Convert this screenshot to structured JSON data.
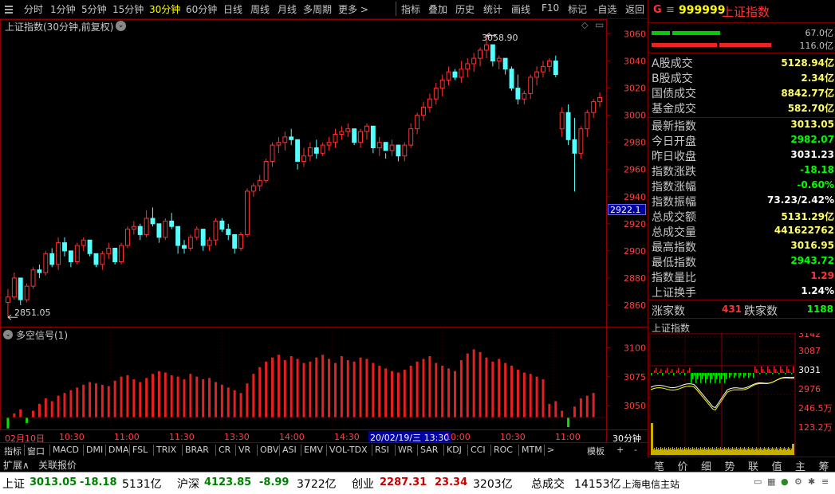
{
  "toolbar": {
    "left": [
      "分时",
      "1分钟",
      "5分钟",
      "15分钟",
      "30分钟",
      "60分钟",
      "日线",
      "周线",
      "月线",
      "多周期",
      "更多 >"
    ],
    "active_index": 4,
    "right": [
      "指标",
      "叠加",
      "历史",
      "统计",
      "画线",
      "F10",
      "标记",
      "-自选",
      "返回"
    ]
  },
  "chart": {
    "title": "上证指数(30分钟,前复权)",
    "high_label": "3058.90",
    "low_label": "2851.05",
    "price_ticks": [
      "3060",
      "3040",
      "3020",
      "3000",
      "2980",
      "2960",
      "2940",
      "2920",
      "2900",
      "2880",
      "2860"
    ],
    "current_tag": "2922.1",
    "indicator_title": "多空信号(1)",
    "indicator_ticks": [
      "3100",
      "3075",
      "3050"
    ],
    "time_labels": [
      "02月10日",
      "10:30",
      "11:00",
      "11:30",
      "13:30",
      "14:00",
      "14:30",
      "20/02/19/三 13:30",
      "10:00",
      "10:30",
      "11:00"
    ],
    "period_label": "30分钟"
  },
  "chart_data": {
    "type": "candlestick",
    "title": "上证指数(30分钟,前复权)",
    "ylim": [
      2850,
      3065
    ],
    "high": 3058.9,
    "low": 2851.05,
    "ohlc": [
      [
        2862,
        2872,
        2851,
        2866
      ],
      [
        2866,
        2884,
        2864,
        2880
      ],
      [
        2880,
        2876,
        2860,
        2864
      ],
      [
        2864,
        2876,
        2862,
        2874
      ],
      [
        2874,
        2888,
        2872,
        2886
      ],
      [
        2886,
        2890,
        2880,
        2884
      ],
      [
        2884,
        2900,
        2882,
        2898
      ],
      [
        2898,
        2902,
        2888,
        2890
      ],
      [
        2890,
        2910,
        2886,
        2906
      ],
      [
        2906,
        2910,
        2896,
        2900
      ],
      [
        2900,
        2898,
        2888,
        2892
      ],
      [
        2892,
        2906,
        2890,
        2904
      ],
      [
        2904,
        2910,
        2900,
        2908
      ],
      [
        2908,
        2906,
        2896,
        2898
      ],
      [
        2898,
        2894,
        2888,
        2890
      ],
      [
        2890,
        2900,
        2886,
        2898
      ],
      [
        2898,
        2906,
        2894,
        2902
      ],
      [
        2902,
        2898,
        2890,
        2892
      ],
      [
        2892,
        2906,
        2890,
        2904
      ],
      [
        2904,
        2918,
        2902,
        2916
      ],
      [
        2916,
        2922,
        2912,
        2918
      ],
      [
        2918,
        2920,
        2908,
        2912
      ],
      [
        2912,
        2930,
        2910,
        2924
      ],
      [
        2924,
        2932,
        2918,
        2920
      ],
      [
        2920,
        2914,
        2906,
        2910
      ],
      [
        2910,
        2924,
        2908,
        2922
      ],
      [
        2922,
        2928,
        2916,
        2918
      ],
      [
        2918,
        2910,
        2898,
        2904
      ],
      [
        2904,
        2908,
        2898,
        2902
      ],
      [
        2902,
        2912,
        2900,
        2910
      ],
      [
        2910,
        2918,
        2908,
        2916
      ],
      [
        2916,
        2912,
        2900,
        2904
      ],
      [
        2904,
        2910,
        2900,
        2908
      ],
      [
        2908,
        2924,
        2904,
        2922
      ],
      [
        2922,
        2924,
        2914,
        2916
      ],
      [
        2916,
        2920,
        2908,
        2912
      ],
      [
        2912,
        2904,
        2898,
        2902
      ],
      [
        2902,
        2914,
        2900,
        2912
      ],
      [
        2912,
        2946,
        2910,
        2944
      ],
      [
        2944,
        2950,
        2940,
        2948
      ],
      [
        2948,
        2956,
        2944,
        2952
      ],
      [
        2952,
        2968,
        2950,
        2966
      ],
      [
        2966,
        2980,
        2962,
        2978
      ],
      [
        2978,
        2984,
        2972,
        2980
      ],
      [
        2980,
        2988,
        2974,
        2984
      ],
      [
        2984,
        2990,
        2978,
        2982
      ],
      [
        2982,
        2964,
        2960,
        2966
      ],
      [
        2966,
        2976,
        2962,
        2970
      ],
      [
        2970,
        2980,
        2966,
        2976
      ],
      [
        2976,
        2982,
        2968,
        2972
      ],
      [
        2972,
        2980,
        2970,
        2978
      ],
      [
        2978,
        2984,
        2974,
        2980
      ],
      [
        2980,
        2990,
        2976,
        2986
      ],
      [
        2986,
        2992,
        2982,
        2988
      ],
      [
        2988,
        2994,
        2984,
        2990
      ],
      [
        2990,
        2982,
        2978,
        2980
      ],
      [
        2980,
        2990,
        2976,
        2988
      ],
      [
        2988,
        2994,
        2982,
        2992
      ],
      [
        2992,
        2980,
        2972,
        2976
      ],
      [
        2976,
        2984,
        2970,
        2980
      ],
      [
        2980,
        2972,
        2968,
        2974
      ],
      [
        2974,
        2982,
        2970,
        2978
      ],
      [
        2978,
        2972,
        2966,
        2970
      ],
      [
        2970,
        2980,
        2966,
        2978
      ],
      [
        2978,
        2994,
        2976,
        2990
      ],
      [
        2990,
        3002,
        2986,
        3000
      ],
      [
        3000,
        3010,
        2996,
        3006
      ],
      [
        3006,
        3016,
        3002,
        3012
      ],
      [
        3012,
        3024,
        3008,
        3020
      ],
      [
        3020,
        3030,
        3014,
        3026
      ],
      [
        3026,
        3036,
        3022,
        3032
      ],
      [
        3032,
        3034,
        3026,
        3028
      ],
      [
        3028,
        3040,
        3024,
        3034
      ],
      [
        3034,
        3042,
        3028,
        3038
      ],
      [
        3038,
        3046,
        3032,
        3042
      ],
      [
        3042,
        3050,
        3036,
        3048
      ],
      [
        3048,
        3058.9,
        3042,
        3052
      ],
      [
        3052,
        3046,
        3036,
        3040
      ],
      [
        3040,
        3044,
        3034,
        3042
      ],
      [
        3042,
        3038,
        3030,
        3034
      ],
      [
        3034,
        3036,
        3018,
        3020
      ],
      [
        3020,
        3030,
        3008,
        3012
      ],
      [
        3012,
        3018,
        3008,
        3016
      ],
      [
        3016,
        3030,
        3012,
        3028
      ],
      [
        3028,
        3036,
        3022,
        3032
      ],
      [
        3032,
        3040,
        3028,
        3036
      ],
      [
        3036,
        3042,
        3032,
        3040
      ],
      [
        3040,
        3044,
        3028,
        3030
      ],
      [
        2990,
        3006,
        2984,
        3002
      ],
      [
        3002,
        3008,
        2978,
        2982
      ],
      [
        2982,
        2998,
        2943.72,
        2972
      ],
      [
        2972,
        2992,
        2968,
        2990
      ],
      [
        2990,
        3004,
        2984,
        3002
      ],
      [
        3002,
        3012,
        2998,
        3010
      ],
      [
        3010,
        3016.95,
        3006,
        3013.05
      ]
    ],
    "signals": [
      -8,
      3,
      6,
      -4,
      5,
      10,
      14,
      12,
      16,
      18,
      20,
      22,
      24,
      26,
      25,
      24,
      23,
      27,
      30,
      31,
      28,
      26,
      29,
      32,
      34,
      33,
      31,
      30,
      28,
      32,
      30,
      28,
      29,
      26,
      24,
      22,
      20,
      18,
      25,
      32,
      37,
      41,
      44,
      46,
      42,
      45,
      43,
      40,
      41,
      44,
      46,
      43,
      40,
      45,
      42,
      41,
      44,
      43,
      40,
      38,
      36,
      34,
      33,
      35,
      38,
      41,
      43,
      45,
      40,
      38,
      36,
      34,
      42,
      47,
      50,
      48,
      44,
      41,
      43,
      40,
      38,
      35,
      33,
      32,
      30,
      28,
      10,
      12,
      5,
      -7,
      8,
      14,
      16,
      18
    ],
    "signal_ylim": [
      3035,
      3110
    ]
  },
  "quotes": {
    "header_code": "999999",
    "header_name": "上证指数",
    "bar1_value": "67.0亿",
    "bar2_value": "116.0亿",
    "rows": [
      {
        "k": "A股成交",
        "v": "5128.94亿",
        "c": "#ffff66"
      },
      {
        "k": "B股成交",
        "v": "2.34亿",
        "c": "#ffff66"
      },
      {
        "k": "国债成交",
        "v": "8842.77亿",
        "c": "#ffff66"
      },
      {
        "k": "基金成交",
        "v": "582.70亿",
        "c": "#ffff66"
      },
      {
        "k": "最新指数",
        "v": "3013.05",
        "c": "#ffff66"
      },
      {
        "k": "今日开盘",
        "v": "2982.07",
        "c": "#00ff00"
      },
      {
        "k": "昨日收盘",
        "v": "3031.23",
        "c": "#ffffff"
      },
      {
        "k": "指数涨跌",
        "v": "-18.18",
        "c": "#00ff00"
      },
      {
        "k": "指数涨幅",
        "v": "-0.60%",
        "c": "#00ff00"
      },
      {
        "k": "指数振幅",
        "v": "73.23/2.42%",
        "c": "#ffffff"
      },
      {
        "k": "总成交额",
        "v": "5131.29亿",
        "c": "#ffff66"
      },
      {
        "k": "总成交量",
        "v": "441622762",
        "c": "#ffff66"
      },
      {
        "k": "最高指数",
        "v": "3016.95",
        "c": "#ffff66"
      },
      {
        "k": "最低指数",
        "v": "2943.72",
        "c": "#00ff00"
      },
      {
        "k": "指数量比",
        "v": "1.29",
        "c": "#ff3333"
      },
      {
        "k": "上证换手",
        "v": "1.24%",
        "c": "#ffffff"
      }
    ],
    "up_label": "涨家数",
    "up_count": "431",
    "down_label": "跌家数",
    "down_count": "1188",
    "mini_title": "上证指数",
    "mini_ticks": [
      "3142",
      "3087",
      "3031",
      "2976",
      "246.5万",
      "123.2万"
    ],
    "tabs": [
      "笔",
      "价",
      "细",
      "势",
      "联",
      "值",
      "主",
      "筹"
    ]
  },
  "bottom": {
    "tabs": [
      "指标",
      "窗口",
      "MACD",
      "DMI",
      "DMA",
      "FSL",
      "TRIX",
      "BRAR",
      "CR",
      "VR",
      "OBV",
      "ASI",
      "EMV",
      "VOL-TDX",
      "RSI",
      "WR",
      "SAR",
      "KDJ",
      "CCI",
      "ROC",
      "MTM",
      ">"
    ],
    "tabs_right": [
      "模板",
      "+",
      "-"
    ],
    "tabs2": [
      "扩展∧",
      "关联报价"
    ]
  },
  "status": {
    "items": [
      {
        "t": "上证",
        "c": "#000000"
      },
      {
        "t": "3013.05",
        "c": "#008000"
      },
      {
        "t": "-18.18",
        "c": "#008000"
      },
      {
        "t": "5131亿",
        "c": "#000000"
      },
      {
        "t": "沪深",
        "c": "#000000"
      },
      {
        "t": "4123.85",
        "c": "#008000"
      },
      {
        "t": "-8.99",
        "c": "#008000"
      },
      {
        "t": "3722亿",
        "c": "#000000"
      },
      {
        "t": "创业",
        "c": "#000000"
      },
      {
        "t": "2287.31",
        "c": "#cc0000"
      },
      {
        "t": "23.34",
        "c": "#cc0000"
      },
      {
        "t": "3203亿",
        "c": "#000000"
      },
      {
        "t": "总成交",
        "c": "#000000"
      },
      {
        "t": "14153亿",
        "c": "#000000"
      },
      {
        "t": "上海电信主站",
        "c": "#000000"
      }
    ]
  }
}
